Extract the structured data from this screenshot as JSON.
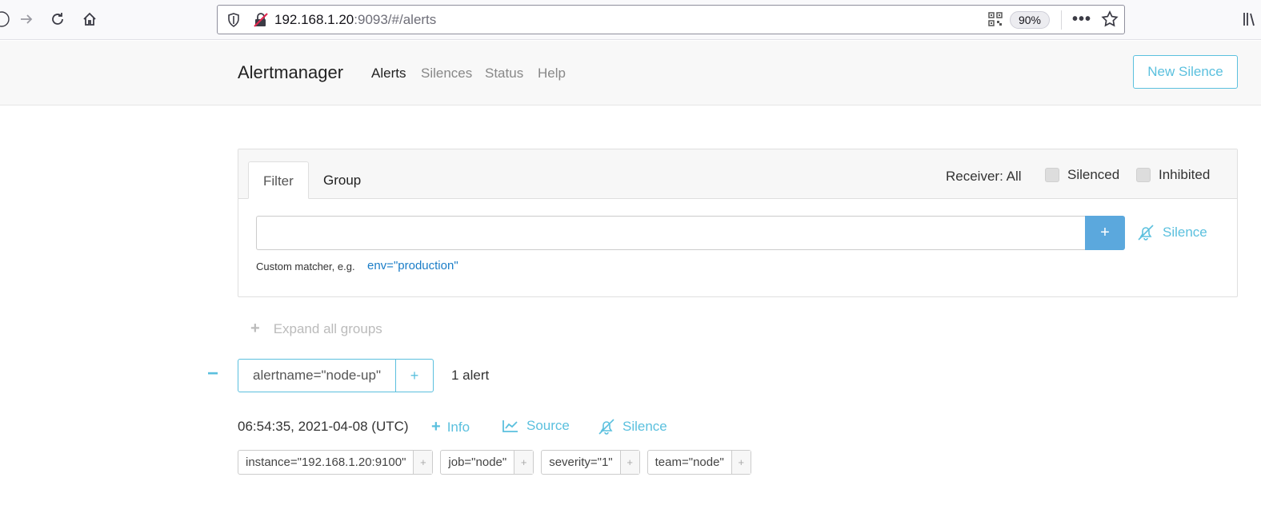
{
  "browser": {
    "url_host": "192.168.1.20",
    "url_rest": ":9093/#/alerts",
    "zoom": "90%"
  },
  "nav": {
    "brand": "Alertmanager",
    "links": [
      "Alerts",
      "Silences",
      "Status",
      "Help"
    ],
    "active": "Alerts",
    "new_silence_label": "New Silence"
  },
  "filter_card": {
    "tabs": [
      "Filter",
      "Group"
    ],
    "receiver_label": "Receiver:",
    "receiver_value": "All",
    "silenced_label": "Silenced",
    "inhibited_label": "Inhibited",
    "input_value": "",
    "add_label": "+",
    "silence_label": "Silence",
    "hint_text": "Custom matcher, e.g.",
    "hint_example": "env=\"production\""
  },
  "expand_all_label": "Expand all groups",
  "group": {
    "collapse_symbol": "−",
    "label": "alertname=\"node-up\"",
    "add_symbol": "+",
    "count": "1 alert"
  },
  "alert": {
    "time": "06:54:35, 2021-04-08 (UTC)",
    "info_label": "Info",
    "source_label": "Source",
    "silence_label": "Silence",
    "labels": [
      "instance=\"192.168.1.20:9100\"",
      "job=\"node\"",
      "severity=\"1\"",
      "team=\"node\""
    ],
    "label_add_symbol": "+"
  },
  "colors": {
    "accent": "#5bc0de",
    "primary_button": "#5ba8dd",
    "link": "#1a7dc7"
  }
}
